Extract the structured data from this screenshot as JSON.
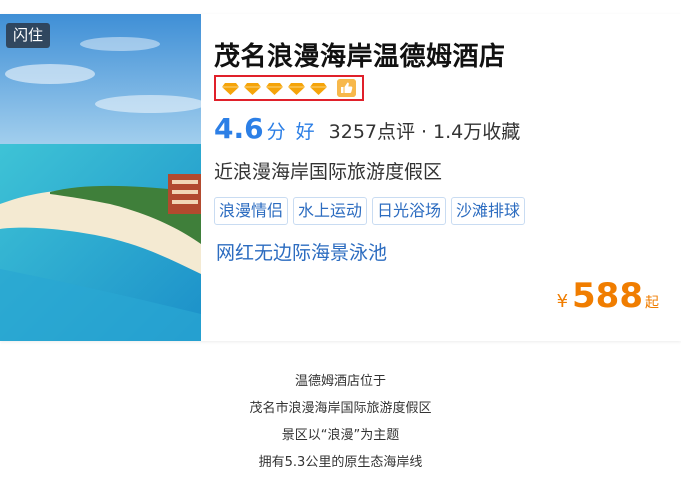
{
  "card": {
    "badge": "闪住",
    "hotel_name": "茂名浪漫海岸温德姆酒店",
    "diamond_rating": 5,
    "score": "4.6",
    "score_unit": "分",
    "score_word": "好",
    "reviews": "3257点评",
    "separator": "·",
    "favorites": "1.4万收藏",
    "location": "近浪漫海岸国际旅游度假区",
    "tags": [
      "浪漫情侣",
      "水上运动",
      "日光浴场",
      "沙滩排球"
    ],
    "highlight": "网红无边际海景泳池",
    "price": {
      "currency": "¥",
      "amount": "588",
      "suffix": "起"
    }
  },
  "article": {
    "lines": [
      "温德姆酒店位于",
      "茂名市浪漫海岸国际旅游度假区",
      "景区以“浪漫”为主题",
      "拥有5.3公里的原生态海岸线"
    ]
  },
  "colors": {
    "accent_blue": "#2c7fe6",
    "price_orange": "#f07d00",
    "diamond_gold": "#f5a40a",
    "highlight_box_red": "#e0202a"
  },
  "icons": {
    "diamond": "diamond-icon",
    "thumb": "thumbs-up-icon"
  }
}
